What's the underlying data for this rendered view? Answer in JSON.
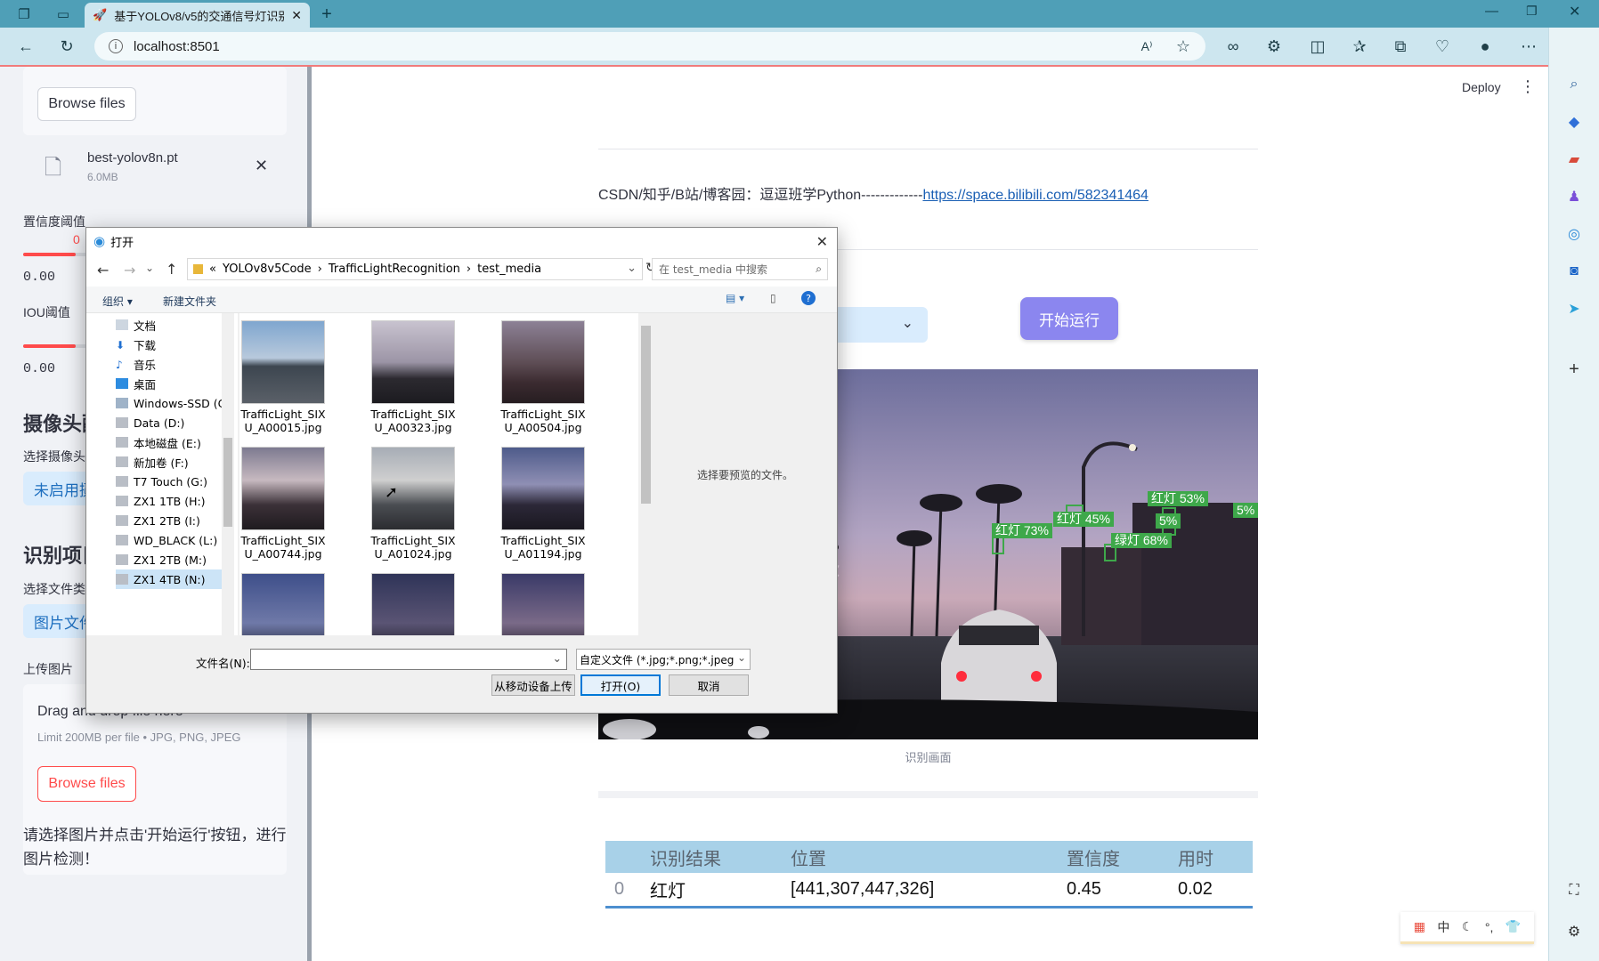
{
  "browser": {
    "tab_title": "基于YOLOv8/v5的交通信号灯识别",
    "url": "localhost:8501"
  },
  "sidebar": {
    "browse_files_label": "Browse files",
    "uploaded_file": {
      "name": "best-yolov8n.pt",
      "size": "6.0MB"
    },
    "conf_label": "置信度阈值",
    "conf_value": "0.00",
    "conf_min_marker": "0",
    "iou_label": "IOU阈值",
    "iou_value": "0.00",
    "camera_header": "摄像头配",
    "camera_select_label": "选择摄像头",
    "camera_select_value": "未启用摄",
    "detect_header": "识别项目",
    "file_type_label": "选择文件类",
    "file_type_value": "图片文件",
    "upload_image_label": "上传图片",
    "drag_text": "Drag and drop file here",
    "limit_text": "Limit 200MB per file • JPG, PNG, JPEG",
    "browse_files_label_2": "Browse files",
    "hint_text": "请选择图片并点击'开始运行'按钮，进行图片检测！"
  },
  "main": {
    "deploy_label": "Deploy",
    "credit_text": "CSDN/知乎/B站/博客园：逗逗班学Python-------------",
    "credit_link": "https://space.bilibili.com/582341464",
    "run_button": "开始运行",
    "image_caption": "识别画面",
    "detections": [
      {
        "label": "红灯 53%"
      },
      {
        "label": "红灯 45%"
      },
      {
        "label": "红灯 73%"
      },
      {
        "label": "绿灯 68%"
      },
      {
        "label": "5%"
      },
      {
        "label": "5%"
      }
    ],
    "table": {
      "columns": [
        "",
        "识别结果",
        "位置",
        "置信度",
        "用时"
      ],
      "rows": [
        [
          "0",
          "红灯",
          "[441,307,447,326]",
          "0.45",
          "0.02"
        ]
      ]
    }
  },
  "dialog": {
    "title": "打开",
    "path": [
      "«",
      "YOLOv8v5Code",
      "TrafficLightRecognition",
      "test_media"
    ],
    "search_placeholder": "在 test_media 中搜索",
    "organize_label": "组织 ▾",
    "new_folder_label": "新建文件夹",
    "tree": [
      "文档",
      "下载",
      "音乐",
      "桌面",
      "Windows-SSD (C",
      "Data (D:)",
      "本地磁盘 (E:)",
      "新加卷 (F:)",
      "T7 Touch (G:)",
      "ZX1 1TB (H:)",
      "ZX1 2TB (I:)",
      "WD_BLACK (L:)",
      "ZX1 2TB (M:)",
      "ZX1 4TB (N:)"
    ],
    "files": [
      "TrafficLight_SIXU_A00015.jpg",
      "TrafficLight_SIXU_A00323.jpg",
      "TrafficLight_SIXU_A00504.jpg",
      "TrafficLight_SIXU_A00744.jpg",
      "TrafficLight_SIXU_A01024.jpg",
      "TrafficLight_SIXU_A01194.jpg"
    ],
    "files_line1": [
      "TrafficLight_SIX",
      "TrafficLight_SIX",
      "TrafficLight_SIX",
      "TrafficLight_SIX",
      "TrafficLight_SIX",
      "TrafficLight_SIX"
    ],
    "files_line2": [
      "U_A00015.jpg",
      "U_A00323.jpg",
      "U_A00504.jpg",
      "U_A00744.jpg",
      "U_A01024.jpg",
      "U_A01194.jpg"
    ],
    "preview_text": "选择要预览的文件。",
    "filename_label": "文件名(N):",
    "filename_value": "",
    "filter_value": "自定义文件 (*.jpg;*.png;*.jpeg",
    "upload_mobile_label": "从移动设备上传",
    "open_label": "打开(O)",
    "cancel_label": "取消"
  },
  "ime": {
    "lang": "中"
  },
  "colors": {
    "accent": "#8b86ef",
    "tab_bar": "#4f9fb7",
    "slider": "#ff4b4b",
    "detection": "#3ea84a",
    "table_header": "#a8d1e8"
  }
}
